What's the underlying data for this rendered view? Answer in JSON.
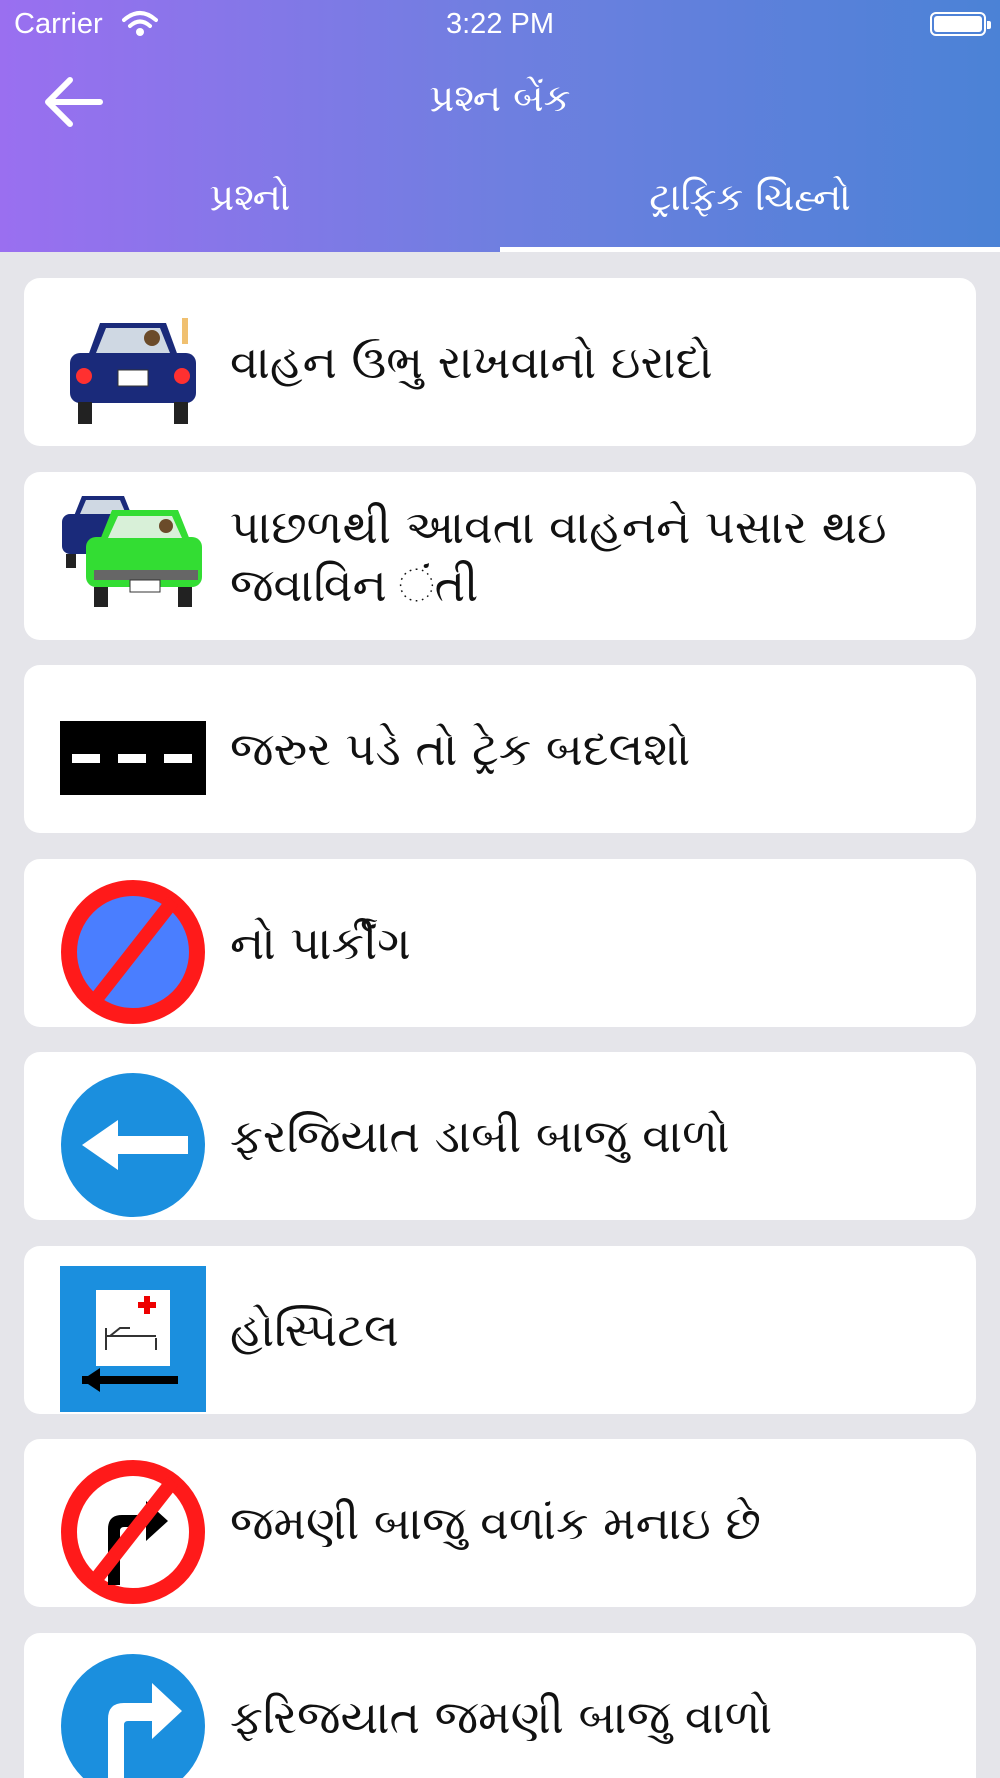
{
  "status_bar": {
    "carrier": "Carrier",
    "time": "3:22 PM"
  },
  "nav": {
    "title": "પ્રશ્ન બેંક"
  },
  "tabs": [
    {
      "label": "પ્રશ્નો",
      "active": false
    },
    {
      "label": "ટ્રાફિક ચિહ્નો",
      "active": true
    }
  ],
  "signs": [
    {
      "label": "વાહન ઉભુ રાખવાનો ઇરાદો",
      "icon": "car-stop-intention-icon"
    },
    {
      "label": "પાછળથી આવતા વાહનને પસાર થઇ જવાવિન ંતી",
      "icon": "car-overtake-request-icon"
    },
    {
      "label": "જરુર પડે તો ટ્રેક બદલશો",
      "icon": "broken-lane-line-icon"
    },
    {
      "label": "નો પાર્કીંગ",
      "icon": "no-parking-icon"
    },
    {
      "label": "ફરજિયાત ડાબી બાજુ વાળો",
      "icon": "compulsory-left-turn-icon"
    },
    {
      "label": "હોસ્પિટલ",
      "icon": "hospital-icon"
    },
    {
      "label": "જમણી બાજુ વળાંક મનાઇ છે",
      "icon": "no-right-turn-icon"
    },
    {
      "label": "ફરિજયાત જમણી બાજુ વાળો",
      "icon": "compulsory-right-turn-icon"
    }
  ],
  "colors": {
    "header_gradient_start": "#9a6ff0",
    "header_gradient_end": "#4b82d6",
    "background": "#e5e5ea",
    "card": "#ffffff",
    "sign_red": "#ff1a1a",
    "sign_blue": "#1b8fde"
  }
}
